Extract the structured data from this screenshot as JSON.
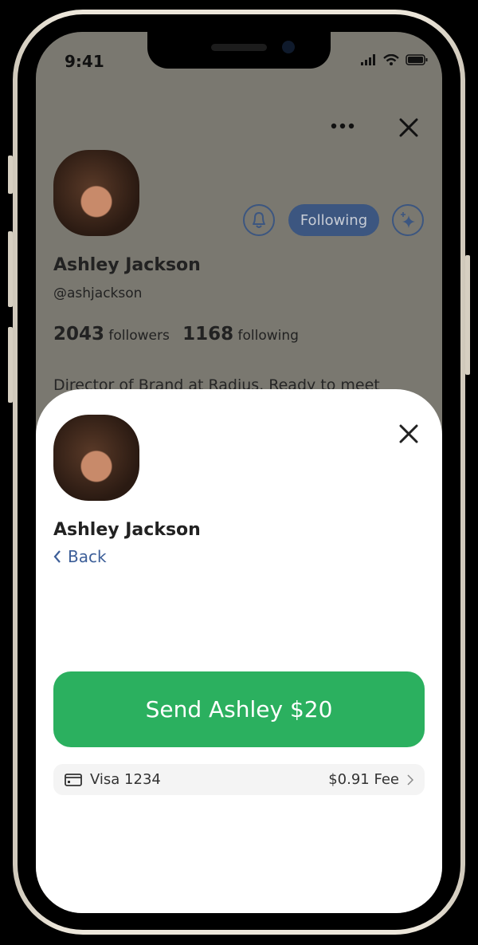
{
  "status_bar": {
    "time": "9:41"
  },
  "profile": {
    "name": "Ashley Jackson",
    "handle": "@ashjackson",
    "followers_count": "2043",
    "followers_label": "followers",
    "following_count": "1168",
    "following_label": "following",
    "bio": "Director of Brand at Radius. Ready to meet",
    "following_button": "Following"
  },
  "sheet": {
    "name": "Ashley Jackson",
    "back_label": "Back",
    "send_button": "Send Ashley $20",
    "payment_method": "Visa 1234",
    "fee": "$0.91 Fee"
  },
  "colors": {
    "accent": "#3c5680",
    "send": "#2bb05f",
    "link": "#3c5e98"
  }
}
